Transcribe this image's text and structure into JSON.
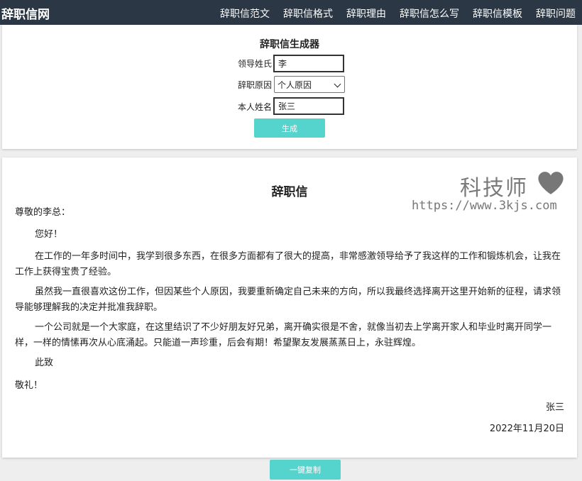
{
  "header": {
    "brand": "辞职信网",
    "nav": [
      "辞职信范文",
      "辞职信格式",
      "辞职理由",
      "辞职信怎么写",
      "辞职信模板",
      "辞职问题"
    ]
  },
  "generator": {
    "title": "辞职信生成器",
    "fields": {
      "leader_label": "领导姓氏",
      "leader_value": "李",
      "reason_label": "辞职原因",
      "reason_value": "个人原因",
      "name_label": "本人姓名",
      "name_value": "张三"
    },
    "generate_label": "生成"
  },
  "letter": {
    "title": "辞职信",
    "salutation": "尊敬的李总：",
    "greeting": "您好！",
    "paragraphs": [
      "在工作的一年多时间中，我学到很多东西，在很多方面都有了很大的提高，非常感激领导给予了我这样的工作和锻炼机会，让我在工作上获得宝贵了经验。",
      "虽然我一直很喜欢这份工作，但因某些个人原因，我要重新确定自己未来的方向，所以我最终选择离开这里开始新的征程，请求领导能够理解我的决定并批准我辞职。",
      "一个公司就是一个大家庭，在这里结识了不少好朋友好兄弟，离开确实很是不舍，就像当初去上学离开家人和毕业时离开同学一样，一样的情愫再次从心底涌起。只能道一声珍重，后会有期！希望聚友发展蒸蒸日上，永驻辉煌。"
    ],
    "closing": "此致",
    "regards": "敬礼！",
    "signature": "张三",
    "date": "2022年11月20日"
  },
  "watermark": {
    "brand": "科技师",
    "url": "https://www.3kjs.com",
    "heart_color": "#777777"
  },
  "copy_label": "一键复制",
  "colors": {
    "topbar": "#2b3744",
    "button": "#55d3cd",
    "background": "#eeeeee"
  }
}
